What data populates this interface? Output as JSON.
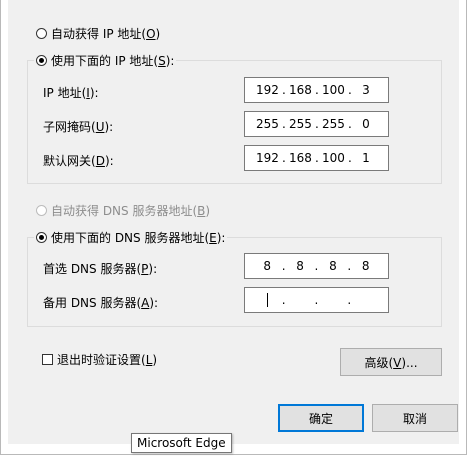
{
  "ip_section": {
    "auto_radio_label": "自动获得 IP 地址(",
    "auto_radio_key": "O",
    "manual_radio_label": "使用下面的 IP 地址(",
    "manual_radio_key": "S",
    "ip_label": "IP 地址(",
    "ip_key": "I",
    "mask_label": "子网掩码(",
    "mask_key": "U",
    "gateway_label": "默认网关(",
    "gateway_key": "D",
    "ip_value": [
      "192",
      "168",
      "100",
      "3"
    ],
    "mask_value": [
      "255",
      "255",
      "255",
      "0"
    ],
    "gateway_value": [
      "192",
      "168",
      "100",
      "1"
    ]
  },
  "dns_section": {
    "auto_radio_label": "自动获得 DNS 服务器地址(",
    "auto_radio_key": "B",
    "manual_radio_label": "使用下面的 DNS 服务器地址(",
    "manual_radio_key": "E",
    "preferred_label": "首选 DNS 服务器(",
    "preferred_key": "P",
    "alternate_label": "备用 DNS 服务器(",
    "alternate_key": "A",
    "preferred_value": [
      "8",
      "8",
      "8",
      "8"
    ],
    "alternate_value": [
      "",
      "",
      "",
      ""
    ]
  },
  "validate_checkbox_label": "退出时验证设置(",
  "validate_checkbox_key": "L",
  "advanced_button_label": "高级(",
  "advanced_button_key": "V",
  "advanced_button_suffix": ")...",
  "ok_button_label": "确定",
  "cancel_button_label": "取消",
  "tooltip_text": "Microsoft Edge",
  "colors": {
    "dialog_bg": "#f0f0f0",
    "primary_border": "#0078d7",
    "disabled_text": "#8d8d8d"
  }
}
